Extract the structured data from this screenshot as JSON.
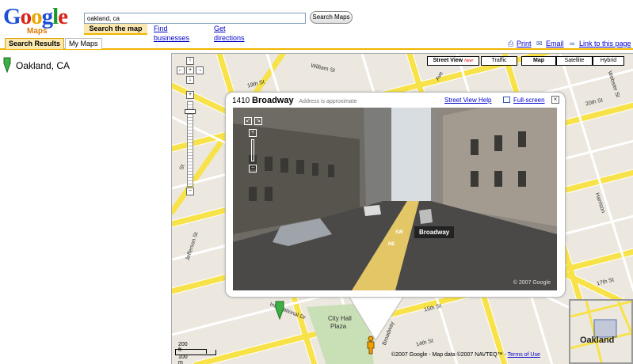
{
  "app": {
    "logo_text": "Google",
    "logo_sub": "Maps"
  },
  "search": {
    "value": "oakland, ca",
    "button_label": "Search Maps"
  },
  "header_tabs": {
    "search_map": "Search the map",
    "find_businesses": "Find businesses",
    "get_directions": "Get directions"
  },
  "subtabs": {
    "search_results": "Search Results",
    "my_maps": "My Maps"
  },
  "utility_links": {
    "print": "Print",
    "email": "Email",
    "link": "Link to this page"
  },
  "result": {
    "label": "Oakland, CA"
  },
  "map_types": {
    "street_view": "Street View",
    "new_tag": "New!",
    "traffic": "Traffic",
    "map": "Map",
    "satellite": "Satellite",
    "hybrid": "Hybrid",
    "active": "Map"
  },
  "streets": {
    "s19": "19th St",
    "william": "William St",
    "ave": "Ave",
    "s20": "20th St",
    "webster": "Webster St",
    "harrison": "Harrison",
    "s17": "17th St",
    "s15": "15th St",
    "s14": "14th St",
    "intl": "International Dr",
    "jefferson": "Jefferson St",
    "plaza": "City Hall",
    "plaza2": "Plaza",
    "broadway": "Broadway",
    "st": "St"
  },
  "infowindow": {
    "number": "1410",
    "street": "Broadway",
    "approx": "Address is approximate",
    "help": "Street View Help",
    "fullscreen": "Full-screen",
    "sv_label": "Broadway",
    "sv_copyright": "© 2007 Google",
    "dir_sw": "SW",
    "dir_ne": "NE"
  },
  "overview": {
    "label": "Oakland"
  },
  "scale": {
    "ft": "200 ft",
    "m": "100 m"
  },
  "footer": {
    "copyright": "©2007 Google - Map data ©2007 NAVTEQ™ - ",
    "terms": "Terms of Use"
  },
  "colors": {
    "road": "#f7e24a",
    "road_edge": "#ffffff",
    "tab_active": "#fbe8b0",
    "accent": "#f0b400",
    "link": "#0000cc"
  }
}
